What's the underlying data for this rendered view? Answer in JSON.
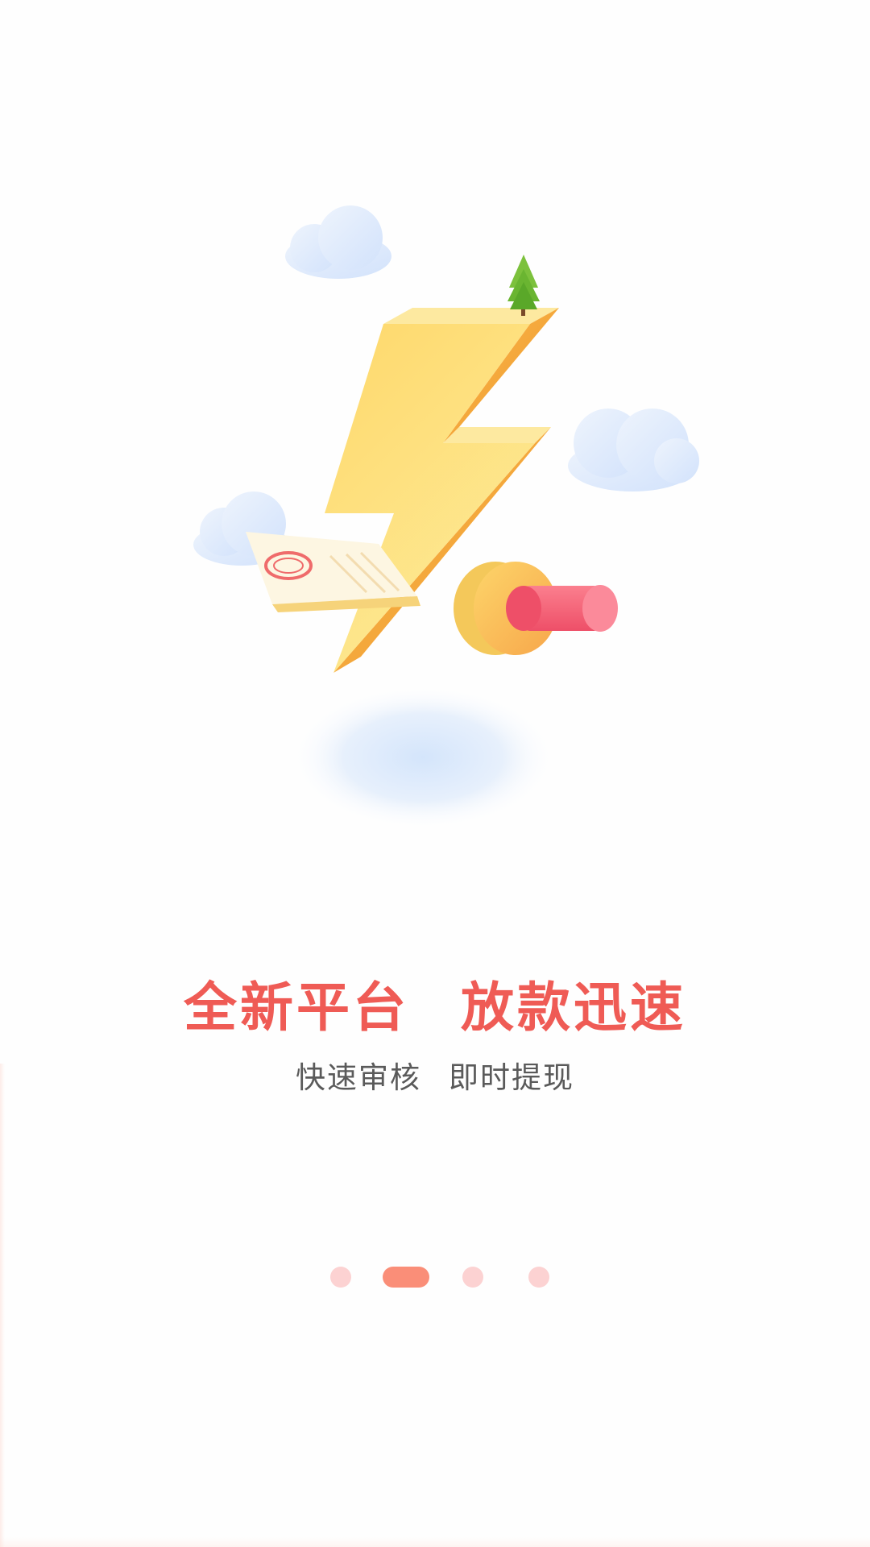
{
  "onboarding": {
    "headline_left": "全新平台",
    "headline_right": "放款迅速",
    "subline_left": "快速审核",
    "subline_right": "即时提现",
    "illustration_icons": [
      "lightning-bolt-icon",
      "tree-icon",
      "cloud-icon",
      "document-ok-stamp-icon",
      "coin-icon"
    ]
  },
  "pager": {
    "total_pages": 4,
    "active_index": 1,
    "active_color": "#fa8e78",
    "inactive_color": "#fcd2d2"
  },
  "colors": {
    "headline": "#ef5b55",
    "subline": "#5a5a5a"
  }
}
